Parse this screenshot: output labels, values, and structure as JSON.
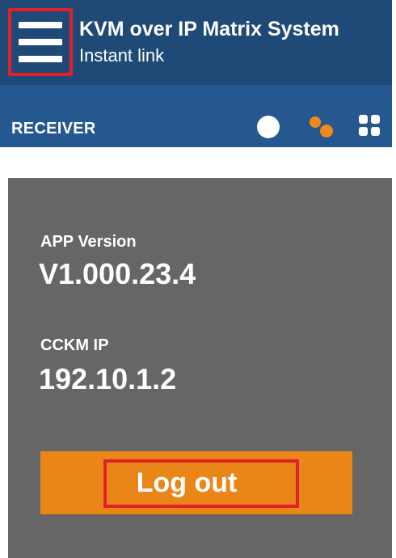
{
  "header": {
    "title": "KVM over IP Matrix System",
    "subtitle": "Instant link",
    "mode_label": "RECEIVER",
    "menu_icon": "hamburger-menu-icon",
    "view_icons": [
      "circle-view-icon",
      "dots-view-icon",
      "grid-view-icon"
    ]
  },
  "info": {
    "app_version_label": "APP Version",
    "app_version_value": "V1.000.23.4",
    "cckm_ip_label": "CCKM IP",
    "cckm_ip_value": "192.10.1.2"
  },
  "actions": {
    "logout_label": "Log out"
  },
  "colors": {
    "header_top": "#1f4a77",
    "header_bottom": "#255790",
    "panel": "#666666",
    "accent": "#ea8618",
    "highlight": "#e0202a"
  }
}
